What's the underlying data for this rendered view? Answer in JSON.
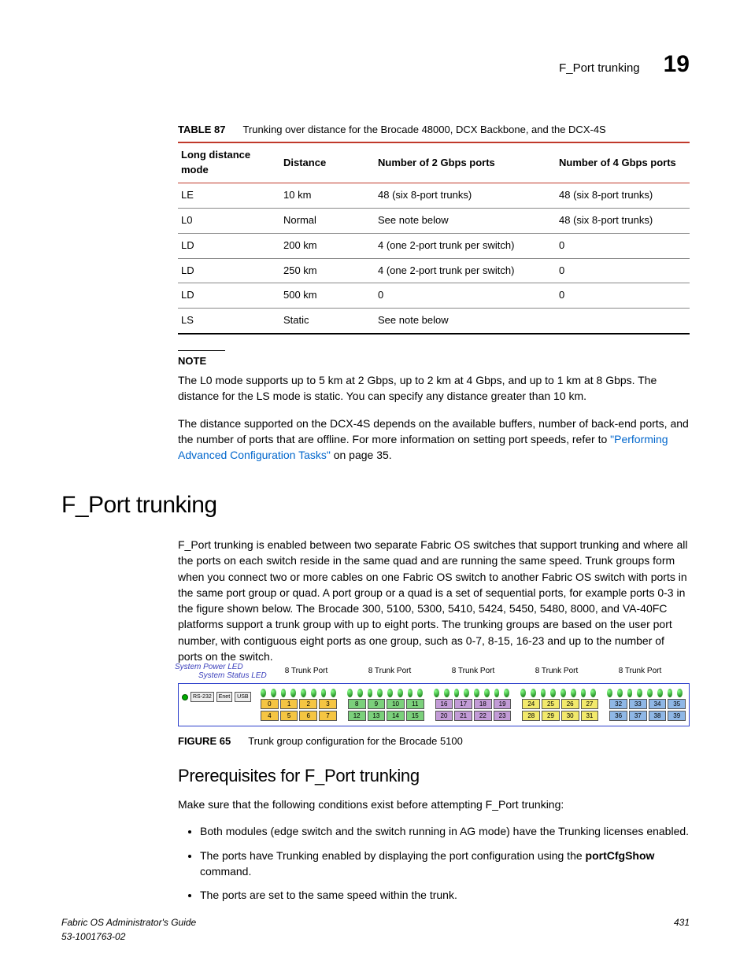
{
  "header": {
    "section_title": "F_Port trunking",
    "chapter_no": "19"
  },
  "table87": {
    "label": "TABLE 87",
    "caption": "Trunking over distance for the Brocade 48000, DCX Backbone, and the DCX-4S",
    "columns": [
      "Long distance mode",
      "Distance",
      "Number of 2 Gbps ports",
      "Number of 4 Gbps ports"
    ],
    "rows": [
      [
        "LE",
        "10 km",
        "48 (six 8-port trunks)",
        "48 (six 8-port trunks)"
      ],
      [
        "L0",
        "Normal",
        "See note below",
        "48 (six 8-port trunks)"
      ],
      [
        "LD",
        "200 km",
        "4 (one 2-port trunk per switch)",
        "0"
      ],
      [
        "LD",
        "250 km",
        "4 (one 2-port trunk per switch)",
        "0"
      ],
      [
        "LD",
        "500 km",
        "0",
        "0"
      ],
      [
        "LS",
        "Static",
        "See note below",
        ""
      ]
    ]
  },
  "note": {
    "label": "NOTE",
    "text": "The L0 mode supports up to 5 km at 2 Gbps, up to 2 km at 4 Gbps, and up to 1 km at 8 Gbps. The distance for the LS mode is static. You can specify any distance greater than 10 km."
  },
  "para_dcx4s_pre": "The distance supported on the DCX-4S depends on the available buffers, number of back-end ports, and the number of ports that are offline. For more information on setting port speeds, refer to ",
  "para_dcx4s_link": "\"Performing Advanced Configuration Tasks\"",
  "para_dcx4s_post": " on page 35.",
  "h1": "F_Port trunking",
  "fport_para": "F_Port trunking is enabled between two separate Fabric OS switches that support trunking and where all the ports on each switch reside in the same quad and are running the same speed. Trunk groups form when you connect two or more cables on one Fabric OS switch to another Fabric OS switch with ports in the same port group or quad. A port group or a quad is a set of sequential ports, for example ports 0-3 in the figure shown below. The Brocade 300, 5100, 5300, 5410, 5424, 5450, 5480, 8000, and VA-40FC platforms support a trunk group with up to eight ports. The trunking groups are based on the user port number, with contiguous eight ports as one group, such as 0-7, 8-15, 16-23 and up to the number of ports on the switch.",
  "figure65": {
    "label": "FIGURE 65",
    "caption": "Trunk group configuration for the Brocade 5100",
    "led_labels": [
      "System Power LED",
      "System Status LED"
    ],
    "trunk_label": "8 Trunk Port",
    "trunk_count": 5,
    "left_boxes": [
      "RS-232",
      "Enet",
      "USB"
    ],
    "top_ports": [
      0,
      1,
      2,
      3,
      8,
      9,
      10,
      11,
      16,
      17,
      18,
      19,
      24,
      25,
      26,
      27,
      32,
      33,
      34,
      35
    ],
    "bottom_ports": [
      4,
      5,
      6,
      7,
      12,
      13,
      14,
      15,
      20,
      21,
      22,
      23,
      28,
      29,
      30,
      31,
      36,
      37,
      38,
      39
    ],
    "group_colors": [
      "c-or",
      "c-gr",
      "c-pu",
      "c-ye",
      "c-bl"
    ]
  },
  "h2": "Prerequisites for F_Port trunking",
  "prereq_intro": "Make sure that the following conditions exist before attempting F_Port trunking:",
  "bullets": [
    {
      "pre": "Both modules (edge switch and the switch running in AG mode) have the Trunking licenses enabled.",
      "cmd": "",
      "post": ""
    },
    {
      "pre": "The ports have Trunking enabled by displaying the port configuration using the ",
      "cmd": "portCfgShow",
      "post": " command."
    },
    {
      "pre": "The ports are set to the same speed within the trunk.",
      "cmd": "",
      "post": ""
    }
  ],
  "footer": {
    "book": "Fabric OS Administrator's Guide",
    "doc_no": "53-1001763-02",
    "page": "431"
  }
}
